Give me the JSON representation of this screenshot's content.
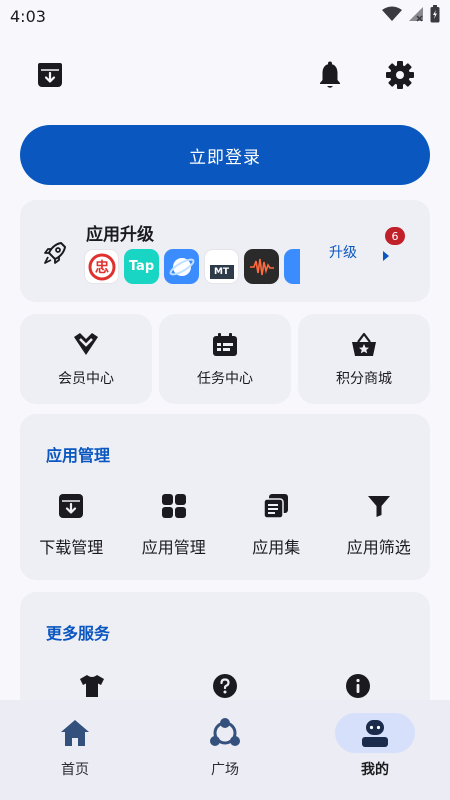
{
  "status_bar": {
    "time": "4:03",
    "icons": [
      "wifi-icon",
      "signal-icon",
      "battery-icon"
    ]
  },
  "topbar": {
    "icons": [
      "download-box-icon",
      "bell-icon",
      "gear-icon"
    ]
  },
  "login": {
    "label": "立即登录"
  },
  "upgrade": {
    "title": "应用升级",
    "action_label": "升级",
    "badge_count": "6",
    "apps": [
      {
        "name": "中国铁路12306",
        "text": "忠",
        "color": "#ffffff"
      },
      {
        "name": "TapTap",
        "text": "Tap",
        "color": "#18d6c3"
      },
      {
        "name": "browser",
        "text": "",
        "color": "#3b8dff"
      },
      {
        "name": "MT管理器",
        "text": "MT",
        "color": "#ffffff"
      },
      {
        "name": "recorder",
        "text": "",
        "color": "#2a2a2a"
      },
      {
        "name": "app6",
        "text": "",
        "color": "#3b8dff"
      }
    ]
  },
  "quick": [
    {
      "label": "会员中心",
      "icon": "vip-diamond-icon"
    },
    {
      "label": "任务中心",
      "icon": "task-calendar-icon"
    },
    {
      "label": "积分商城",
      "icon": "shopping-basket-star-icon"
    }
  ],
  "manage": {
    "title": "应用管理",
    "items": [
      {
        "label": "下载管理",
        "icon": "download-box-icon"
      },
      {
        "label": "应用管理",
        "icon": "apps-grid-icon"
      },
      {
        "label": "应用集",
        "icon": "collection-icon"
      },
      {
        "label": "应用筛选",
        "icon": "filter-icon"
      }
    ]
  },
  "more": {
    "title": "更多服务",
    "items": [
      {
        "icon": "tshirt-icon"
      },
      {
        "icon": "help-circle-icon"
      },
      {
        "icon": "info-circle-icon"
      }
    ]
  },
  "nav": [
    {
      "label": "首页",
      "icon": "home-icon",
      "active": false
    },
    {
      "label": "广场",
      "icon": "community-icon",
      "active": false
    },
    {
      "label": "我的",
      "icon": "profile-icon",
      "active": true
    }
  ],
  "colors": {
    "accent": "#0a57c0",
    "badge": "#c0202a",
    "card": "#eeeef5",
    "background": "#f8f8fc"
  }
}
